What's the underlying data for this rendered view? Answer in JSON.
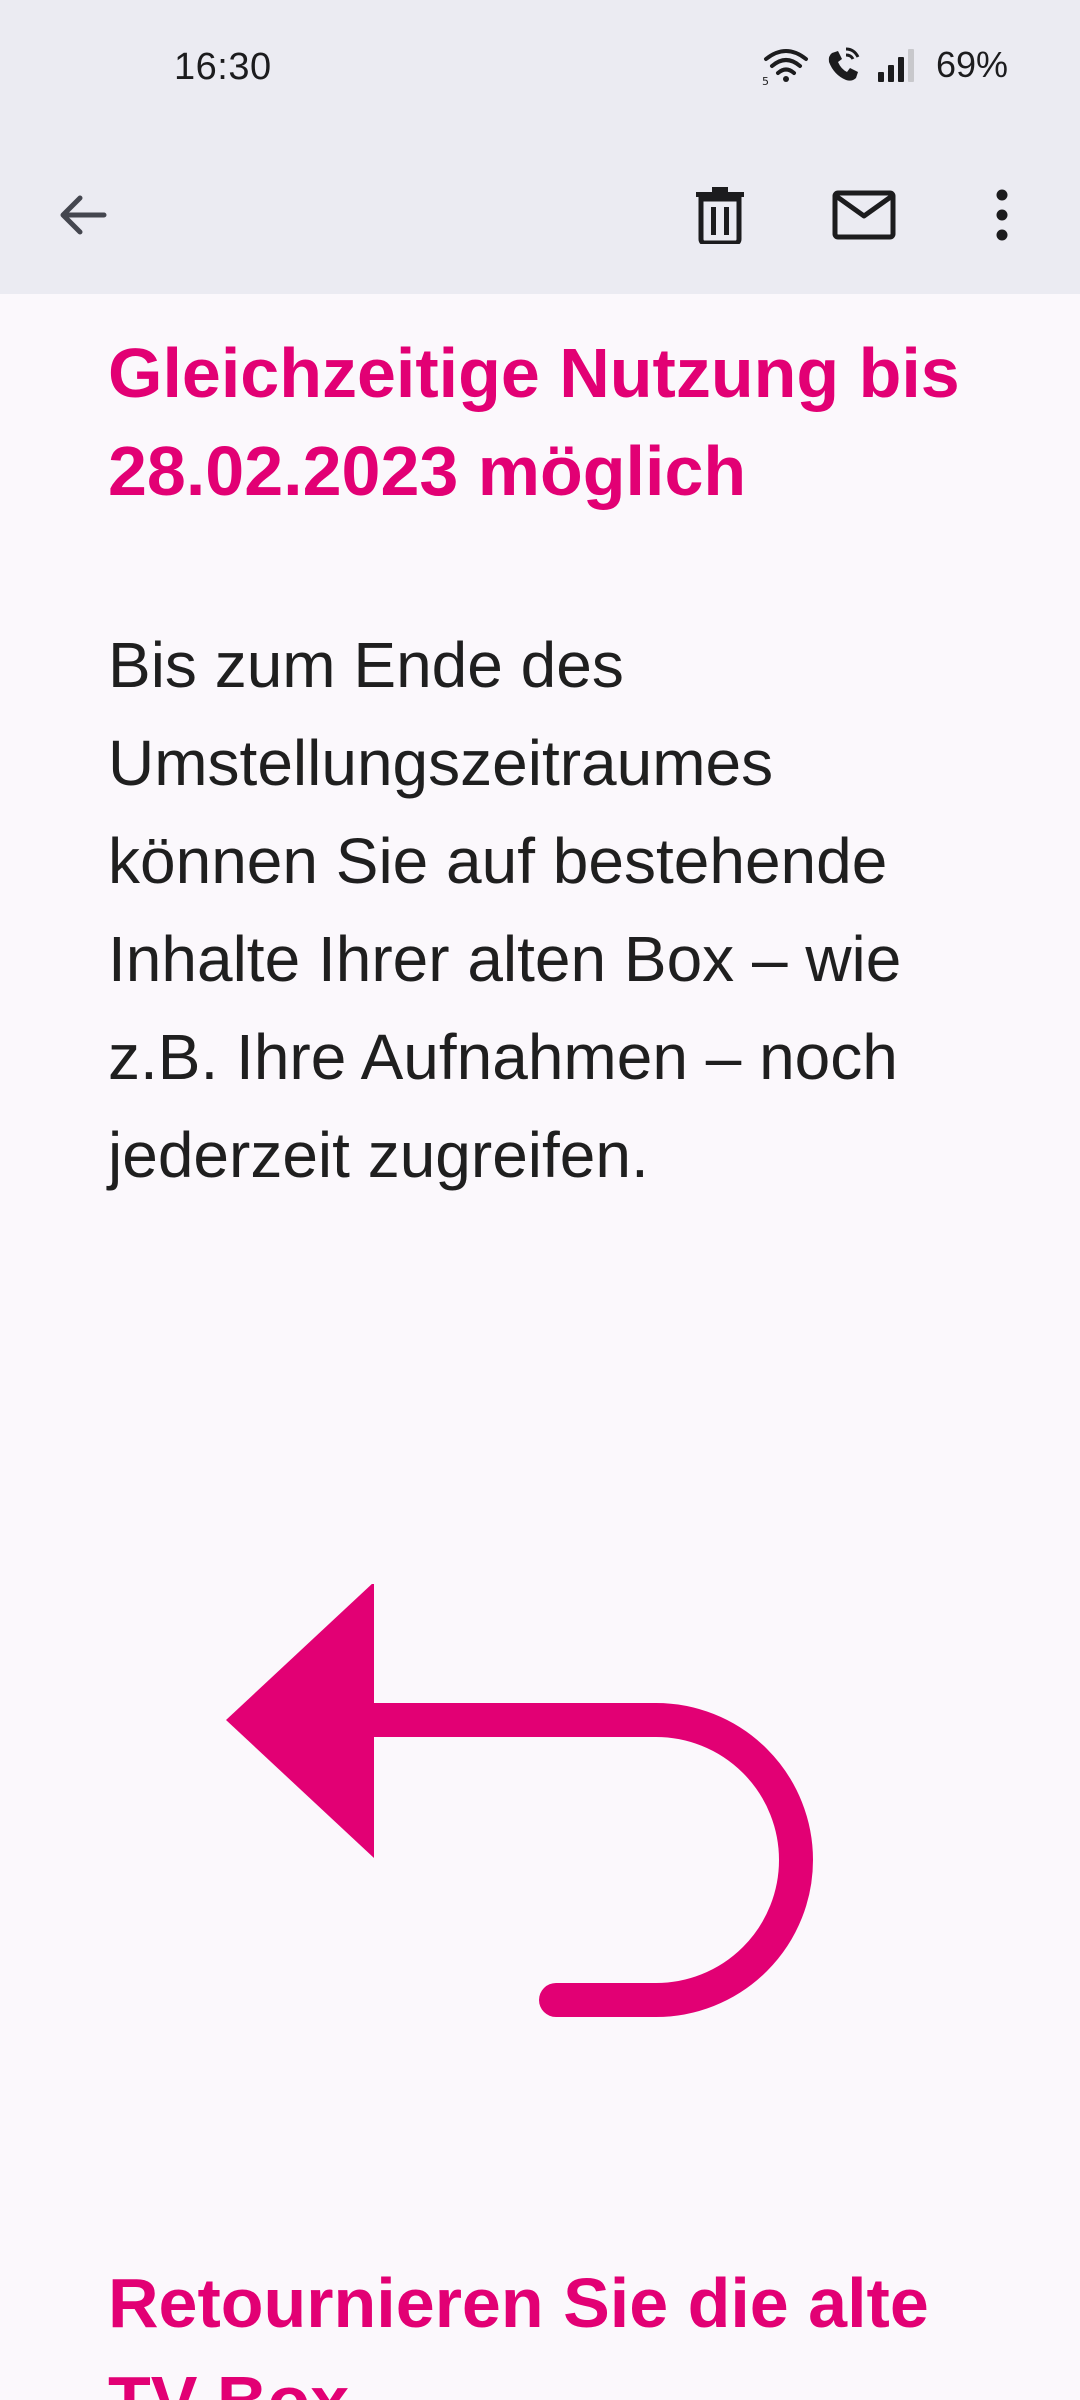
{
  "status_bar": {
    "time": "16:30",
    "battery": "69%",
    "icons": [
      "wifi-icon",
      "wifi-calling-icon",
      "signal-icon"
    ]
  },
  "app_bar": {
    "icons": [
      "back-arrow-icon",
      "delete-icon",
      "mark-unread-icon",
      "more-vert-icon"
    ]
  },
  "email": {
    "heading1": "Gleichzeitige Nutzung bis 28.02.2023 möglich",
    "body": "Bis zum Ende des\nUmstellungszeitraumes\nkönnen Sie  auf bestehende\nInhalte Ihrer alten Box – wie\nz.B. Ihre Aufnahmen – noch\njederzeit zugreifen.",
    "graphic": "return-arrow-icon",
    "heading2": "Retournieren Sie die alte TV-Box"
  },
  "colors": {
    "brand_magenta": "#e20074",
    "toolbar_bg": "#ebebf2",
    "content_bg": "#fbf8fc"
  }
}
